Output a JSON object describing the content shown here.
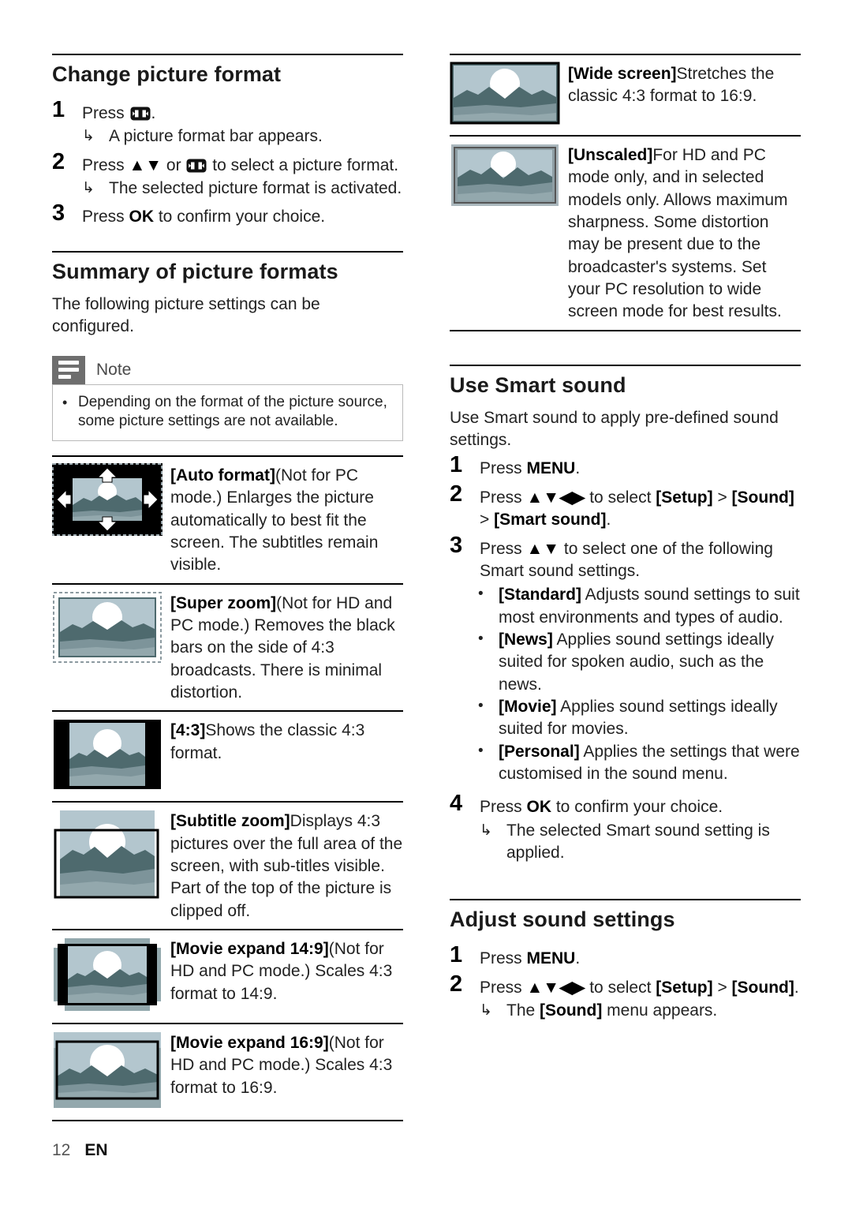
{
  "footer": {
    "page_number": "12",
    "language": "EN"
  },
  "left_column": {
    "change_picture_format": {
      "title": "Change picture format",
      "steps": [
        {
          "num": "1",
          "text_before": "Press ",
          "icon": "picture-format-key-icon",
          "text_after": ".",
          "sub": [
            {
              "arrow": "↳",
              "text": "A picture format bar appears."
            }
          ]
        },
        {
          "num": "2",
          "text_before": "Press ",
          "nav": "▲▼",
          "mid": " or ",
          "icon": "picture-format-key-icon",
          "text_after": " to select a picture format.",
          "sub": [
            {
              "arrow": "↳",
              "text": "The selected picture format is activated."
            }
          ]
        },
        {
          "num": "3",
          "text_before": "Press ",
          "bold": "OK",
          "text_after": " to confirm your choice.",
          "sub": []
        }
      ]
    },
    "summary_of_picture_formats": {
      "title": "Summary of picture formats",
      "intro": "The following picture settings can be configured.",
      "note": {
        "label": "Note",
        "icon": "note-lines-icon",
        "bullet": "•",
        "text": "Depending on the format of the picture source, some picture settings are not available."
      },
      "rows": [
        {
          "thumb": "auto-format-thumbnail",
          "name": "[Auto format]",
          "desc": "(Not for PC mode.) Enlarges the picture automatically to best fit the screen. The subtitles remain visible."
        },
        {
          "thumb": "super-zoom-thumbnail",
          "name": "[Super zoom]",
          "desc": "(Not for HD and PC mode.) Removes the black bars on the side of 4:3 broadcasts. There is minimal distortion."
        },
        {
          "thumb": "four-three-thumbnail",
          "name": "[4:3]",
          "desc": "Shows the classic 4:3 format."
        },
        {
          "thumb": "subtitle-zoom-thumbnail",
          "name": "[Subtitle zoom]",
          "desc": "Displays 4:3 pictures over the full area of the screen, with sub-titles visible. Part of the top of the picture is clipped off."
        },
        {
          "thumb": "movie-expand-14-9-thumbnail",
          "name": "[Movie expand 14:9]",
          "desc": "(Not for HD and PC mode.) Scales 4:3 format to 14:9."
        },
        {
          "thumb": "movie-expand-16-9-thumbnail",
          "name": "[Movie expand 16:9]",
          "desc": "(Not for HD and PC mode.) Scales 4:3 format to 16:9."
        }
      ]
    }
  },
  "right_column": {
    "format_rows_continued": [
      {
        "thumb": "wide-screen-thumbnail",
        "name": "[Wide screen]",
        "desc": "Stretches the classic 4:3 format to 16:9."
      },
      {
        "thumb": "unscaled-thumbnail",
        "name": "[Unscaled]",
        "desc": "For HD and PC mode only, and in selected models only. Allows maximum sharpness. Some distortion may be present due to the broadcaster's systems. Set your PC resolution to wide screen mode for best results."
      }
    ],
    "use_smart_sound": {
      "title": "Use Smart sound",
      "intro": "Use Smart sound to apply pre-defined sound settings.",
      "steps": [
        {
          "num": "1",
          "text_before": "Press ",
          "bold": "MENU",
          "text_after": "."
        },
        {
          "num": "2",
          "text_before": "Press ",
          "nav": "▲▼◀▶",
          "text_mid": " to select ",
          "bold1": "[Setup]",
          "sep1": " > ",
          "bold2": "[Sound]",
          "sep2": " > ",
          "bold3": "[Smart sound]",
          "text_after": "."
        },
        {
          "num": "3",
          "text_before": "Press ",
          "nav": "▲▼",
          "text_after": " to select one of the following Smart sound settings."
        }
      ],
      "settings": [
        {
          "bullet": "•",
          "name": "[Standard]",
          "desc": " Adjusts sound settings to suit most environments and types of audio."
        },
        {
          "bullet": "•",
          "name": "[News]",
          "desc": " Applies sound settings ideally suited for spoken audio, such as the news."
        },
        {
          "bullet": "•",
          "name": "[Movie]",
          "desc": " Applies sound settings ideally suited for movies."
        },
        {
          "bullet": "•",
          "name": "[Personal]",
          "desc": " Applies the settings that were customised in the sound menu."
        }
      ],
      "final_step": {
        "num": "4",
        "text_before": "Press ",
        "bold": "OK",
        "text_after": " to confirm your choice.",
        "sub": {
          "arrow": "↳",
          "text": "The selected Smart sound setting is applied."
        }
      }
    },
    "adjust_sound_settings": {
      "title": "Adjust sound settings",
      "steps": [
        {
          "num": "1",
          "text_before": "Press ",
          "bold": "MENU",
          "text_after": "."
        },
        {
          "num": "2",
          "text_before": "Press ",
          "nav": "▲▼◀▶",
          "text_mid": " to select ",
          "bold1": "[Setup]",
          "sep1": " > ",
          "bold2": "[Sound]",
          "text_after": ".",
          "sub": {
            "arrow": "↳",
            "text_before": "The ",
            "bold": "[Sound]",
            "text_after": " menu appears."
          }
        }
      ]
    }
  },
  "colors": {
    "sky": "#b3c6ce",
    "mountain": "#4e6a6e",
    "midground": "#7d949a",
    "foreground": "#93a8ad",
    "sun": "#ffffff",
    "letterbox": "#000000",
    "note_icon_bg": "#6e6e6e"
  }
}
